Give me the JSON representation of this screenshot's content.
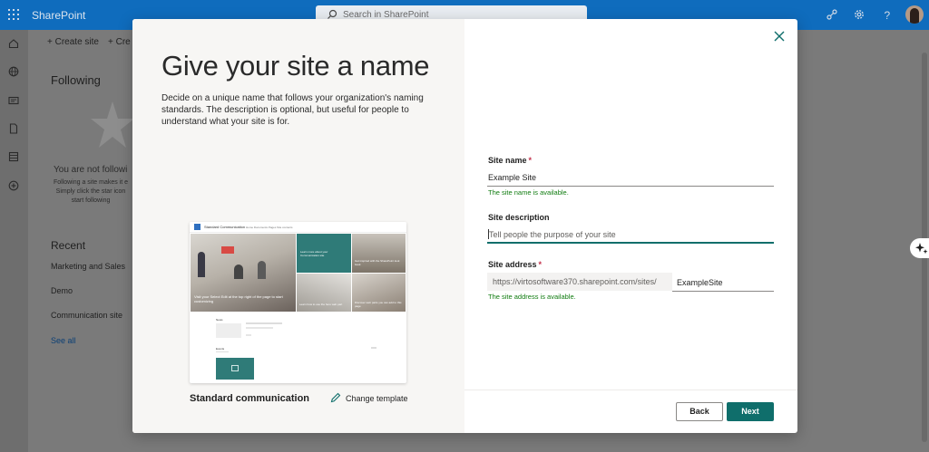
{
  "topbar": {
    "brand": "SharePoint",
    "search_placeholder": "Search in SharePoint"
  },
  "command_bar": {
    "create_site": "Create site",
    "create_news": "Cre"
  },
  "background": {
    "following_title": "Following",
    "not_following": "You are not followi",
    "not_following_desc": "Following a site makes it e Simply click the star icon start following",
    "recent_title": "Recent",
    "recent_items": [
      "Marketing and Sales",
      "Demo",
      "Communication site"
    ],
    "see_all": "See all"
  },
  "dialog": {
    "title": "Give your site a name",
    "description": "Decide on a unique name that follows your organization's naming standards. The description is optional, but useful for people to understand what your site is for.",
    "template_name": "Standard communication",
    "change_template": "Change template",
    "thumbnail": {
      "site_title": "Standard Communication",
      "nav": "Home  Documents  Pages  Site contents",
      "hero_main": "Visit your Select Edit at the top right of the page to start customizing",
      "hero_2": "Learn more about your Communication site",
      "hero_3": "Get inspired with the SharePoint look book",
      "hero_4": "Learn how to use the hero web part",
      "hero_5": "Discover web parts you can add to this page",
      "news_label": "News",
      "events_label": "Events"
    },
    "fields": {
      "site_name_label": "Site name",
      "site_name_value": "Example Site",
      "site_name_status": "The site name is available.",
      "site_description_label": "Site description",
      "site_description_placeholder": "Tell people the purpose of your site",
      "site_address_label": "Site address",
      "site_address_prefix": "https://virtosoftware370.sharepoint.com/sites/",
      "site_address_value": "ExampleSite",
      "site_address_status": "The site address is available.",
      "required_marker": "*"
    },
    "back_label": "Back",
    "next_label": "Next"
  },
  "colors": {
    "suite_bar": "#0f6cbd",
    "accent": "#0f6e6b",
    "success": "#107c10",
    "required": "#c4314b"
  }
}
